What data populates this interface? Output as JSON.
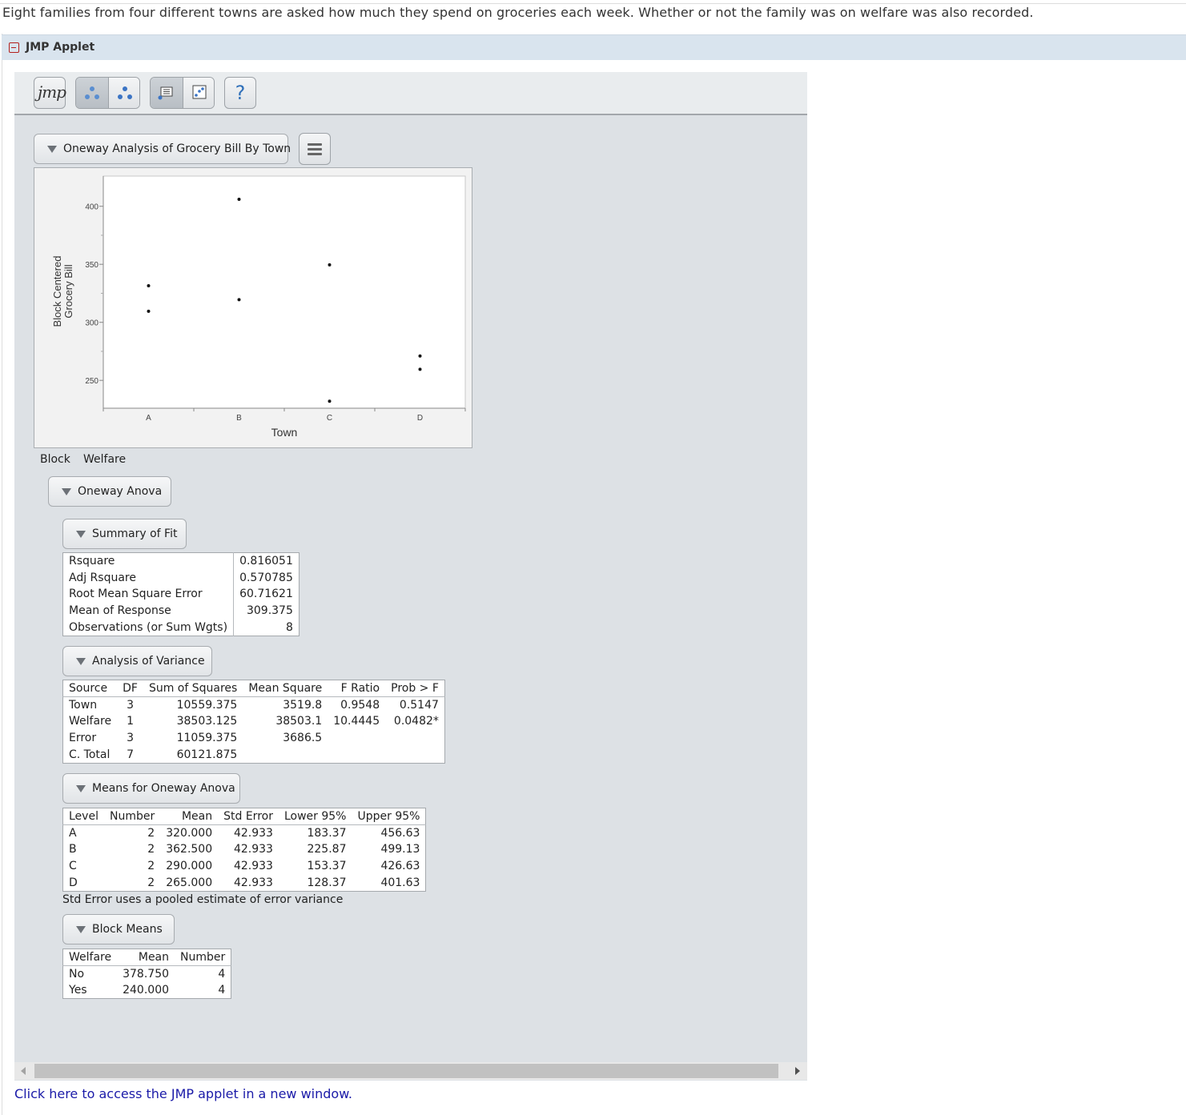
{
  "intro_text": "Eight families from four different towns are asked how much they spend on groceries each week. Whether or not the family was on welfare was also recorded.",
  "section": {
    "title": "JMP Applet",
    "toggle_icon": "collapse-icon"
  },
  "toolbar": {
    "logo_text": "jmp",
    "help_label": "?",
    "icons": [
      "jmp-logo-icon",
      "points-view-icon",
      "points-alt-view-icon",
      "report-view-icon",
      "graph-view-icon",
      "help-icon"
    ]
  },
  "report": {
    "header": "Oneway Analysis of Grocery Bill By Town",
    "menu_icon": "hamburger-menu-icon",
    "block_label": "Block",
    "block_var": "Welfare",
    "oneway_anova": "Oneway Anova",
    "summary_of_fit": {
      "title": "Summary of Fit",
      "rows": [
        {
          "label": "Rsquare",
          "value": "0.816051"
        },
        {
          "label": "Adj Rsquare",
          "value": "0.570785"
        },
        {
          "label": "Root Mean Square Error",
          "value": "60.71621"
        },
        {
          "label": "Mean of Response",
          "value": "309.375"
        },
        {
          "label": "Observations (or Sum Wgts)",
          "value": "8"
        }
      ]
    },
    "anova": {
      "title": "Analysis of Variance",
      "headers": [
        "Source",
        "DF",
        "Sum of Squares",
        "Mean Square",
        "F Ratio",
        "Prob > F"
      ],
      "rows": [
        [
          "Town",
          "3",
          "10559.375",
          "3519.8",
          "0.9548",
          "0.5147"
        ],
        [
          "Welfare",
          "1",
          "38503.125",
          "38503.1",
          "10.4445",
          "0.0482*"
        ],
        [
          "Error",
          "3",
          "11059.375",
          "3686.5",
          "",
          ""
        ],
        [
          "C. Total",
          "7",
          "60121.875",
          "",
          "",
          ""
        ]
      ]
    },
    "means": {
      "title": "Means for Oneway Anova",
      "headers": [
        "Level",
        "Number",
        "Mean",
        "Std Error",
        "Lower 95%",
        "Upper 95%"
      ],
      "rows": [
        [
          "A",
          "2",
          "320.000",
          "42.933",
          "183.37",
          "456.63"
        ],
        [
          "B",
          "2",
          "362.500",
          "42.933",
          "225.87",
          "499.13"
        ],
        [
          "C",
          "2",
          "290.000",
          "42.933",
          "153.37",
          "426.63"
        ],
        [
          "D",
          "2",
          "265.000",
          "42.933",
          "128.37",
          "401.63"
        ]
      ],
      "note": "Std Error uses a pooled estimate of error variance"
    },
    "block_means": {
      "title": "Block Means",
      "headers": [
        "Welfare",
        "Mean",
        "Number"
      ],
      "rows": [
        [
          "No",
          "378.750",
          "4"
        ],
        [
          "Yes",
          "240.000",
          "4"
        ]
      ]
    }
  },
  "chart_data": {
    "type": "scatter",
    "xlabel": "Town",
    "ylabel": "Block Centered Grocery Bill",
    "categories": [
      "A",
      "B",
      "C",
      "D"
    ],
    "yticks": [
      250,
      300,
      350,
      400
    ],
    "ylim": [
      226,
      426
    ],
    "points": [
      {
        "x": "A",
        "y": 331.5
      },
      {
        "x": "A",
        "y": 309.5
      },
      {
        "x": "B",
        "y": 406
      },
      {
        "x": "B",
        "y": 319.5
      },
      {
        "x": "C",
        "y": 349.5
      },
      {
        "x": "C",
        "y": 232
      },
      {
        "x": "D",
        "y": 271
      },
      {
        "x": "D",
        "y": 259.5
      }
    ],
    "grid": false,
    "legend": "none"
  },
  "link_text": "Click here to access the JMP applet in a new window."
}
